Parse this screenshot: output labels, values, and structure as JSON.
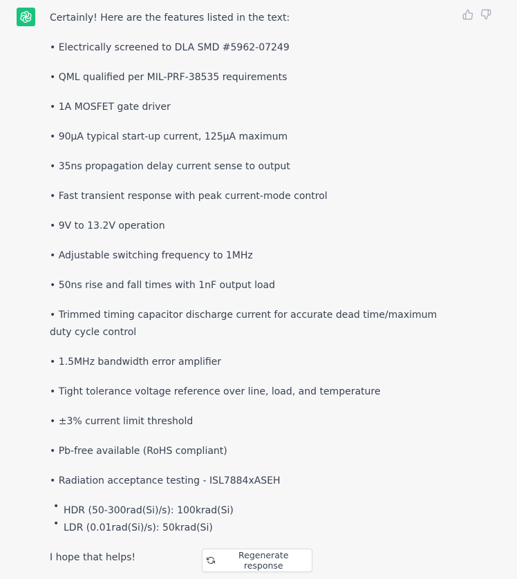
{
  "assistant": {
    "avatar_icon": "openai-logo-icon",
    "avatar_color": "#19c37d"
  },
  "actions": {
    "thumbs_up_icon": "thumbs-up-icon",
    "thumbs_down_icon": "thumbs-down-icon"
  },
  "message": {
    "intro": "Certainly! Here are the features listed in the text:",
    "features": [
      "• Electrically screened to DLA SMD #5962-07249",
      "• QML qualified per MIL-PRF-38535 requirements",
      "• 1A MOSFET gate driver",
      "• 90μA typical start-up current, 125μA maximum",
      "• 35ns propagation delay current sense to output",
      "• Fast transient response with peak current-mode control",
      "• 9V to 13.2V operation",
      "• Adjustable switching frequency to 1MHz",
      "• 50ns rise and fall times with 1nF output load",
      "• Trimmed timing capacitor discharge current for accurate dead time/maximum duty cycle control",
      "• 1.5MHz bandwidth error amplifier",
      "• Tight tolerance voltage reference over line, load, and temperature",
      "• ±3% current limit threshold",
      "• Pb-free available (RoHS compliant)",
      "• Radiation acceptance testing - ISL7884xASEH"
    ],
    "sub_bullet": "•",
    "sub_items": [
      "HDR (50-300rad(Si)/s): 100krad(Si)",
      "LDR (0.01rad(Si)/s): 50krad(Si)"
    ],
    "closing": "I hope that helps!"
  },
  "regenerate": {
    "icon": "refresh-icon",
    "label": "Regenerate response"
  }
}
